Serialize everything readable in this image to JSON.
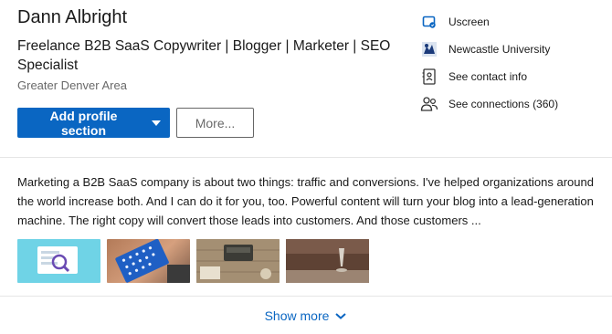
{
  "profile": {
    "name": "Dann Albright",
    "headline": "Freelance B2B SaaS Copywriter | Blogger | Marketer | SEO Specialist",
    "location": "Greater Denver Area"
  },
  "actions": {
    "add_section_label": "Add profile section",
    "more_label": "More..."
  },
  "sidebar": {
    "items": [
      {
        "label": "Uscreen",
        "icon": "company-icon"
      },
      {
        "label": "Newcastle University",
        "icon": "university-logo"
      },
      {
        "label": "See contact info",
        "icon": "contact-card-icon"
      },
      {
        "label": "See connections (360)",
        "icon": "people-icon"
      }
    ]
  },
  "summary": {
    "text": "Marketing a B2B SaaS company is about two things: traffic and conversions. I've helped organizations around the world increase both. And I can do it for you, too. Powerful content will turn your blog into a lead-generation machine. The right copy will convert those leads into customers. And those customers ..."
  },
  "media": {
    "thumbnails": [
      "media-thumbnail-1",
      "media-thumbnail-2",
      "media-thumbnail-3",
      "media-thumbnail-4"
    ]
  },
  "footer": {
    "show_more_label": "Show more"
  },
  "colors": {
    "accent": "#0a66c2"
  }
}
